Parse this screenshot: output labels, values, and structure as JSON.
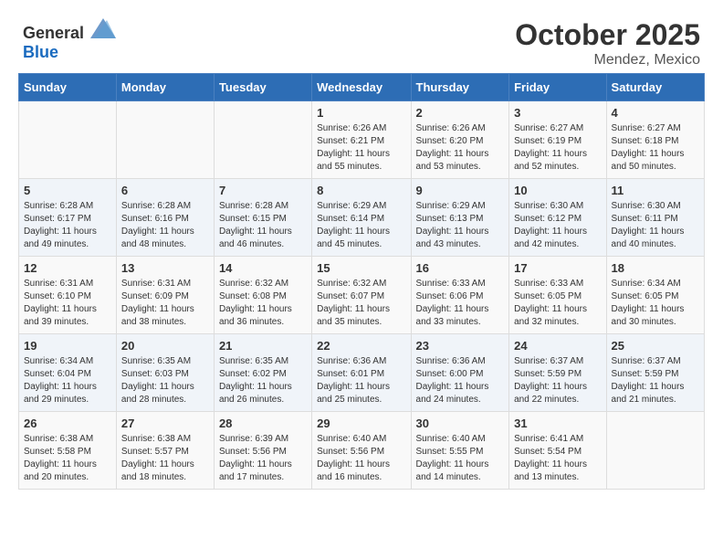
{
  "header": {
    "logo_general": "General",
    "logo_blue": "Blue",
    "month": "October 2025",
    "location": "Mendez, Mexico"
  },
  "days_of_week": [
    "Sunday",
    "Monday",
    "Tuesday",
    "Wednesday",
    "Thursday",
    "Friday",
    "Saturday"
  ],
  "weeks": [
    [
      {
        "day": "",
        "info": ""
      },
      {
        "day": "",
        "info": ""
      },
      {
        "day": "",
        "info": ""
      },
      {
        "day": "1",
        "sunrise": "6:26 AM",
        "sunset": "6:21 PM",
        "daylight": "11 hours and 55 minutes."
      },
      {
        "day": "2",
        "sunrise": "6:26 AM",
        "sunset": "6:20 PM",
        "daylight": "11 hours and 53 minutes."
      },
      {
        "day": "3",
        "sunrise": "6:27 AM",
        "sunset": "6:19 PM",
        "daylight": "11 hours and 52 minutes."
      },
      {
        "day": "4",
        "sunrise": "6:27 AM",
        "sunset": "6:18 PM",
        "daylight": "11 hours and 50 minutes."
      }
    ],
    [
      {
        "day": "5",
        "sunrise": "6:28 AM",
        "sunset": "6:17 PM",
        "daylight": "11 hours and 49 minutes."
      },
      {
        "day": "6",
        "sunrise": "6:28 AM",
        "sunset": "6:16 PM",
        "daylight": "11 hours and 48 minutes."
      },
      {
        "day": "7",
        "sunrise": "6:28 AM",
        "sunset": "6:15 PM",
        "daylight": "11 hours and 46 minutes."
      },
      {
        "day": "8",
        "sunrise": "6:29 AM",
        "sunset": "6:14 PM",
        "daylight": "11 hours and 45 minutes."
      },
      {
        "day": "9",
        "sunrise": "6:29 AM",
        "sunset": "6:13 PM",
        "daylight": "11 hours and 43 minutes."
      },
      {
        "day": "10",
        "sunrise": "6:30 AM",
        "sunset": "6:12 PM",
        "daylight": "11 hours and 42 minutes."
      },
      {
        "day": "11",
        "sunrise": "6:30 AM",
        "sunset": "6:11 PM",
        "daylight": "11 hours and 40 minutes."
      }
    ],
    [
      {
        "day": "12",
        "sunrise": "6:31 AM",
        "sunset": "6:10 PM",
        "daylight": "11 hours and 39 minutes."
      },
      {
        "day": "13",
        "sunrise": "6:31 AM",
        "sunset": "6:09 PM",
        "daylight": "11 hours and 38 minutes."
      },
      {
        "day": "14",
        "sunrise": "6:32 AM",
        "sunset": "6:08 PM",
        "daylight": "11 hours and 36 minutes."
      },
      {
        "day": "15",
        "sunrise": "6:32 AM",
        "sunset": "6:07 PM",
        "daylight": "11 hours and 35 minutes."
      },
      {
        "day": "16",
        "sunrise": "6:33 AM",
        "sunset": "6:06 PM",
        "daylight": "11 hours and 33 minutes."
      },
      {
        "day": "17",
        "sunrise": "6:33 AM",
        "sunset": "6:05 PM",
        "daylight": "11 hours and 32 minutes."
      },
      {
        "day": "18",
        "sunrise": "6:34 AM",
        "sunset": "6:05 PM",
        "daylight": "11 hours and 30 minutes."
      }
    ],
    [
      {
        "day": "19",
        "sunrise": "6:34 AM",
        "sunset": "6:04 PM",
        "daylight": "11 hours and 29 minutes."
      },
      {
        "day": "20",
        "sunrise": "6:35 AM",
        "sunset": "6:03 PM",
        "daylight": "11 hours and 28 minutes."
      },
      {
        "day": "21",
        "sunrise": "6:35 AM",
        "sunset": "6:02 PM",
        "daylight": "11 hours and 26 minutes."
      },
      {
        "day": "22",
        "sunrise": "6:36 AM",
        "sunset": "6:01 PM",
        "daylight": "11 hours and 25 minutes."
      },
      {
        "day": "23",
        "sunrise": "6:36 AM",
        "sunset": "6:00 PM",
        "daylight": "11 hours and 24 minutes."
      },
      {
        "day": "24",
        "sunrise": "6:37 AM",
        "sunset": "5:59 PM",
        "daylight": "11 hours and 22 minutes."
      },
      {
        "day": "25",
        "sunrise": "6:37 AM",
        "sunset": "5:59 PM",
        "daylight": "11 hours and 21 minutes."
      }
    ],
    [
      {
        "day": "26",
        "sunrise": "6:38 AM",
        "sunset": "5:58 PM",
        "daylight": "11 hours and 20 minutes."
      },
      {
        "day": "27",
        "sunrise": "6:38 AM",
        "sunset": "5:57 PM",
        "daylight": "11 hours and 18 minutes."
      },
      {
        "day": "28",
        "sunrise": "6:39 AM",
        "sunset": "5:56 PM",
        "daylight": "11 hours and 17 minutes."
      },
      {
        "day": "29",
        "sunrise": "6:40 AM",
        "sunset": "5:56 PM",
        "daylight": "11 hours and 16 minutes."
      },
      {
        "day": "30",
        "sunrise": "6:40 AM",
        "sunset": "5:55 PM",
        "daylight": "11 hours and 14 minutes."
      },
      {
        "day": "31",
        "sunrise": "6:41 AM",
        "sunset": "5:54 PM",
        "daylight": "11 hours and 13 minutes."
      },
      {
        "day": "",
        "info": ""
      }
    ]
  ],
  "labels": {
    "sunrise": "Sunrise:",
    "sunset": "Sunset:",
    "daylight": "Daylight:"
  }
}
